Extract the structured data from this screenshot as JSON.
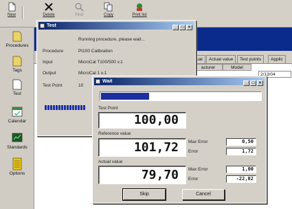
{
  "toolbar": {
    "buttons": [
      {
        "label": "New",
        "icon": "document-icon"
      },
      {
        "label": "Delete",
        "icon": "delete-x-icon"
      },
      {
        "label": "Find",
        "icon": "find-icon"
      },
      {
        "label": "Copy",
        "icon": "copy-icon"
      },
      {
        "label": "Print list",
        "icon": "print-list-icon"
      }
    ]
  },
  "sidebar": {
    "items": [
      {
        "label": "Procedures",
        "icon": "procedures-icon"
      },
      {
        "label": "Tags",
        "icon": "tags-icon"
      },
      {
        "label": "Test",
        "icon": "test-icon"
      },
      {
        "label": "Calendar",
        "icon": "calendar-icon"
      },
      {
        "label": "Standards",
        "icon": "standards-icon"
      },
      {
        "label": "Options",
        "icon": "options-icon"
      }
    ]
  },
  "background_grid": {
    "tabs": [
      "ual",
      "Actual value",
      "Test points",
      "Applic"
    ],
    "headers": [
      "acturer",
      "Model"
    ],
    "cell": "2/13/04"
  },
  "test_window": {
    "title": "Test",
    "status": "Running procedure, please wait...",
    "fields": [
      {
        "label": "Procedure",
        "value": "Pt100 Calibration"
      },
      {
        "label": "Input",
        "value": "MicroCal T100/500 v.1"
      },
      {
        "label": "Output",
        "value": "MicroCal 1 v.1"
      },
      {
        "label": "Test Point",
        "value": "10"
      }
    ]
  },
  "wait_dialog": {
    "title": "Wait",
    "progress_fraction": 0.3,
    "test_point_label": "Test Point",
    "test_point_value": "100,00",
    "reference_label": "Reference value",
    "reference_value": "101,72",
    "reference_max_error_label": "Max Error",
    "reference_max_error": "0,50",
    "reference_error_label": "Error",
    "reference_error": "1,72",
    "actual_label": "Actual value",
    "actual_value": "79,70",
    "actual_max_error_label": "Max Error",
    "actual_max_error": "1,00",
    "actual_error_label": "Error",
    "actual_error": "-22,02",
    "skip_label": "Skip",
    "cancel_label": "Cancel"
  },
  "colors": {
    "title_active": "#0a246a",
    "progress": "#1c2ea0",
    "window_face": "#d4d0c8"
  }
}
